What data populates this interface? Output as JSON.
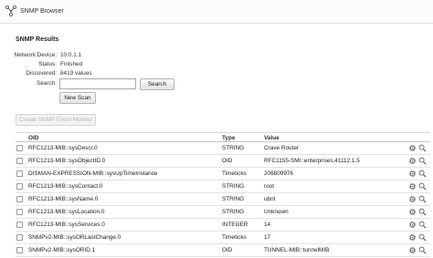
{
  "window": {
    "title": "SNMP Browser"
  },
  "section_title": "SNMP Results",
  "info": [
    {
      "label": "Network Device:",
      "value": "10.0.1.1"
    },
    {
      "label": "Status:",
      "value": "Finished"
    },
    {
      "label": "Discovered:",
      "value": "8419 values"
    }
  ],
  "search": {
    "label": "Search:",
    "value": "",
    "button": "Search"
  },
  "new_scan_button": "New Scan",
  "create_monitor_button": "Create SNMP Event Monitor",
  "table": {
    "headers": {
      "oid": "OID",
      "type": "Type",
      "value": "Value"
    },
    "rows": [
      {
        "oid": "RFC1213-MIB::sysDescr.0",
        "type": "STRING",
        "value": "Crave Router"
      },
      {
        "oid": "RFC1213-MIB::sysObjectID.0",
        "type": "OID",
        "value": "RFC1155-SMI::enterprises.41112.1.5"
      },
      {
        "oid": "DISMAN-EXPRESSION-MIB::sysUpTimeInstance",
        "type": "Timeticks",
        "value": "206809976"
      },
      {
        "oid": "RFC1213-MIB::sysContact.0",
        "type": "STRING",
        "value": "root"
      },
      {
        "oid": "RFC1213-MIB::sysName.0",
        "type": "STRING",
        "value": "ubnt"
      },
      {
        "oid": "RFC1213-MIB::sysLocation.0",
        "type": "STRING",
        "value": "Unknown"
      },
      {
        "oid": "RFC1213-MIB::sysServices.0",
        "type": "INTEGER",
        "value": "14"
      },
      {
        "oid": "SNMPv2-MIB::sysORLastChange.0",
        "type": "Timeticks",
        "value": "17"
      },
      {
        "oid": "SNMPv2-MIB::sysORID.1",
        "type": "OID",
        "value": "TUNNEL-MIB::tunnelMIB"
      }
    ]
  },
  "icons": {
    "title": "network-nodes-icon",
    "row_actions": [
      "gear-icon",
      "magnifier-icon"
    ]
  },
  "colors": {
    "title_bar": "#fbfbfb",
    "border": "#d6d6d6",
    "disabled_text": "#b9b9b9"
  }
}
